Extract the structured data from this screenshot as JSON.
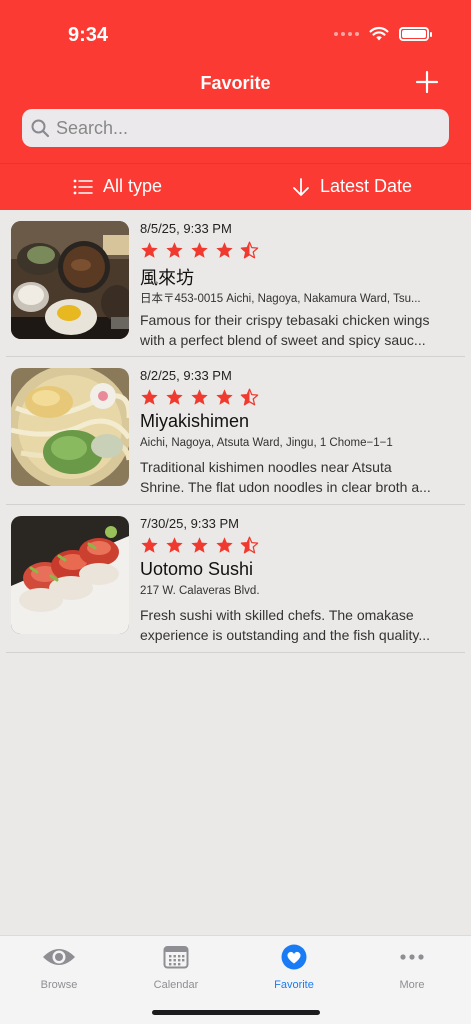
{
  "status": {
    "time": "9:34"
  },
  "nav": {
    "title": "Favorite"
  },
  "search": {
    "placeholder": "Search..."
  },
  "filters": {
    "type_label": "All type",
    "sort_label": "Latest Date"
  },
  "colors": {
    "brand_red": "#fa3a33",
    "star_red": "#f13a2f",
    "tab_active_blue": "#1a7cf5",
    "tab_inactive": "#8e8e93"
  },
  "items": [
    {
      "date": "8/5/25, 9:33 PM",
      "rating": 4.5,
      "name": "風來坊",
      "address": "日本〒453-0015 Aichi, Nagoya, Nakamura Ward, Tsu...",
      "desc_line1": "Famous for their crispy tebasaki chicken wings",
      "desc_line2": "with a perfect blend of sweet and spicy sauc...",
      "photo": "japanese-set-meal-photo"
    },
    {
      "date": "8/2/25, 9:33 PM",
      "rating": 4.5,
      "name": "Miyakishimen",
      "address": "Aichi, Nagoya, Atsuta Ward, Jingu, 1 Chome−1−1",
      "desc_line1": "Traditional kishimen noodles near Atsuta",
      "desc_line2": "Shrine. The flat udon noodles in clear broth a...",
      "photo": "kishimen-noodle-bowl-photo"
    },
    {
      "date": "7/30/25, 9:33 PM",
      "rating": 4.5,
      "name": "Uotomo Sushi",
      "address": "217 W. Calaveras Blvd.",
      "desc_line1": "Fresh sushi with skilled chefs. The omakase",
      "desc_line2": "experience is outstanding and the fish quality...",
      "photo": "sushi-roll-photo"
    }
  ],
  "tabs": [
    {
      "label": "Browse",
      "icon": "eye-icon"
    },
    {
      "label": "Calendar",
      "icon": "calendar-icon"
    },
    {
      "label": "Favorite",
      "icon": "heart-icon",
      "active": true
    },
    {
      "label": "More",
      "icon": "ellipsis-icon"
    }
  ]
}
